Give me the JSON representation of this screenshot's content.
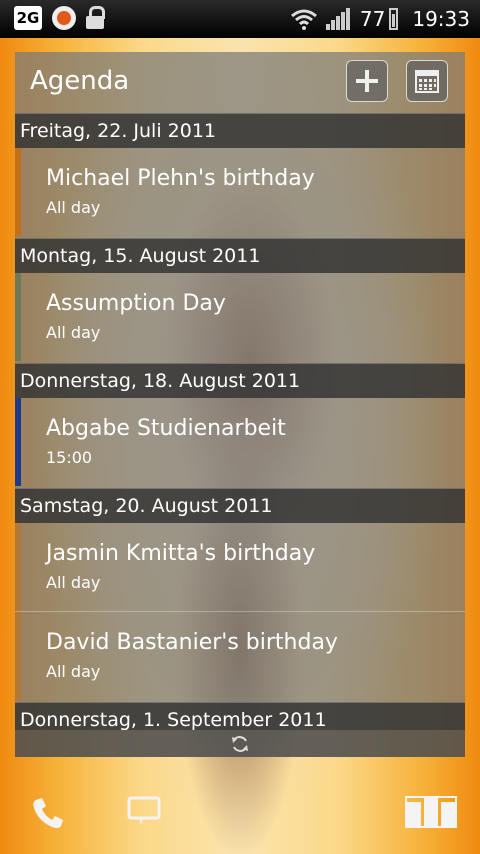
{
  "status_bar": {
    "network_label": "2G",
    "battery_level": "77",
    "time": "19:33",
    "icons": [
      "network-2g-icon",
      "recording-icon",
      "lock-icon",
      "wifi-icon",
      "signal-icon",
      "battery-icon"
    ]
  },
  "widget": {
    "title": "Agenda",
    "add_icon": "plus-icon",
    "calendar_icon": "calendar-icon",
    "days": [
      {
        "header": "Freitag, 22. Juli 2011",
        "events": [
          {
            "title": "Michael Plehn's birthday",
            "time": "All day",
            "color": "#c0701a"
          }
        ]
      },
      {
        "header": "Montag, 15. August 2011",
        "events": [
          {
            "title": "Assumption Day",
            "time": "All day",
            "color": "#6d7a5a"
          }
        ]
      },
      {
        "header": "Donnerstag, 18. August 2011",
        "events": [
          {
            "title": "Abgabe Studienarbeit",
            "time": "15:00",
            "color": "#1d3a8c"
          }
        ]
      },
      {
        "header": "Samstag, 20. August 2011",
        "events": [
          {
            "title": "Jasmin Kmitta's birthday",
            "time": "All day",
            "color": "#b0783a"
          },
          {
            "title": "David Bastanier's birthday",
            "time": "All day",
            "color": "#b0783a"
          }
        ]
      },
      {
        "header": "Donnerstag, 1. September 2011",
        "events": []
      }
    ]
  },
  "dock": {
    "icons": [
      "phone-icon",
      "messages-icon",
      "app-drawer-icon"
    ]
  }
}
